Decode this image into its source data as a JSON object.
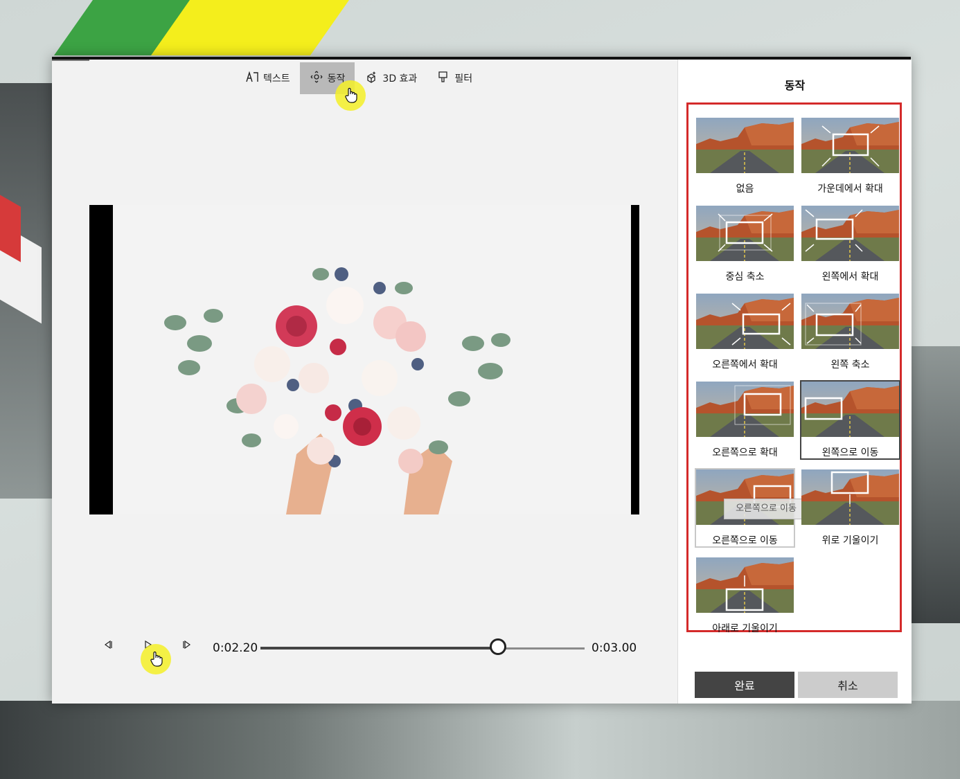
{
  "toolbar": {
    "items": [
      {
        "label": "텍스트",
        "icon": "text-icon"
      },
      {
        "label": "동작",
        "icon": "motion-icon"
      },
      {
        "label": "3D 효과",
        "icon": "3d-effects-icon"
      },
      {
        "label": "필터",
        "icon": "filter-icon"
      }
    ],
    "active": "동작"
  },
  "playback": {
    "current_time": "0:02.20",
    "total_time": "0:03.00",
    "progress": 0.733
  },
  "panel": {
    "title": "동작",
    "motions": [
      {
        "label": "없음"
      },
      {
        "label": "가운데에서 확대"
      },
      {
        "label": "중심 축소"
      },
      {
        "label": "왼쪽에서 확대"
      },
      {
        "label": "오른쪽에서 확대"
      },
      {
        "label": "왼쪽 축소"
      },
      {
        "label": "오른쪽으로 확대"
      },
      {
        "label": "왼쪽으로 이동"
      },
      {
        "label": "오른쪽으로 이동"
      },
      {
        "label": "위로 기울이기"
      },
      {
        "label": "아래로 기울이기"
      }
    ],
    "selected": "왼쪽으로 이동",
    "tooltip": "오른쪽으로 이동",
    "done_label": "완료",
    "cancel_label": "취소"
  },
  "colors": {
    "highlight": "#d42a2a",
    "done_bg": "#444444",
    "cancel_bg": "#cccccc",
    "cursor_highlight": "#f5f028"
  }
}
